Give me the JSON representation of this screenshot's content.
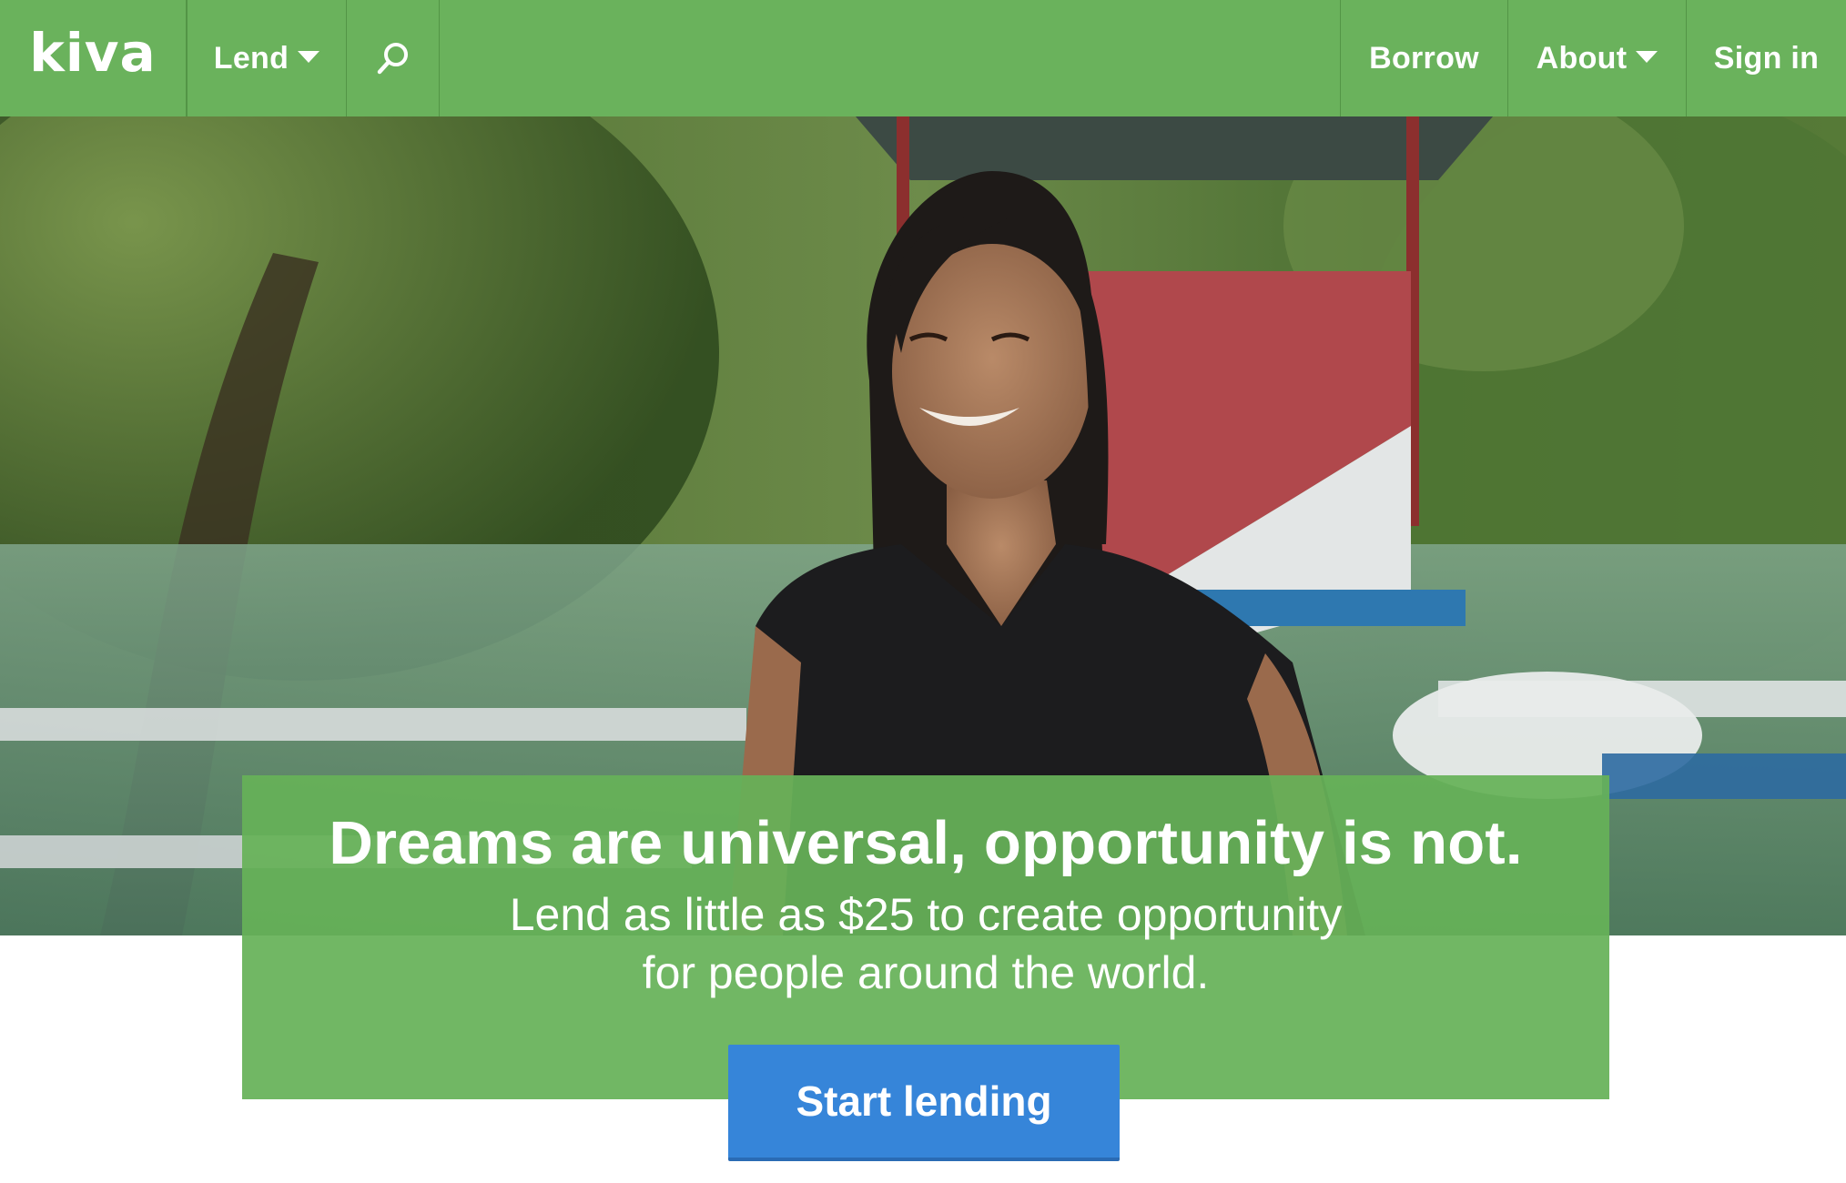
{
  "nav": {
    "logo": "kiva",
    "lend": "Lend",
    "search_icon": "search-icon",
    "borrow": "Borrow",
    "about": "About",
    "sign_in": "Sign in"
  },
  "hero": {
    "headline": "Dreams are universal, opportunity is not.",
    "sub_line_1": "Lend as little as $25 to create opportunity",
    "sub_line_2": "for people around the world.",
    "cta": "Start lending"
  },
  "colors": {
    "brand_green": "#6ab25c",
    "cta_blue": "#3685d9"
  }
}
